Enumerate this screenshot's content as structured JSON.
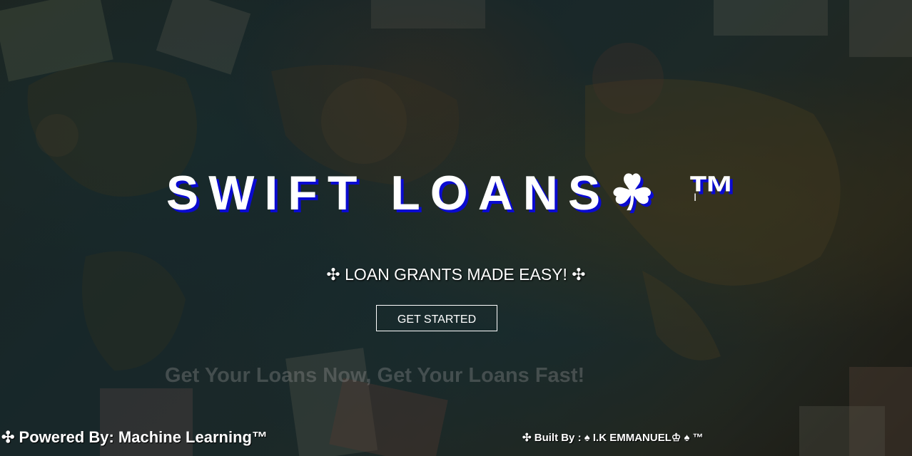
{
  "hero": {
    "title": "SWIFT LOANS☘ ™",
    "tagline": "✣ LOAN GRANTS MADE EASY! ✣",
    "cta_label": "GET STARTED",
    "slogan": "Get Your Loans Now, Get Your Loans Fast!"
  },
  "footer": {
    "powered_by": "✣ Powered By: Machine Learning™",
    "built_by": "✣ Built By : ♠ I.K EMMANUEL♔ ♠ ™"
  },
  "colors": {
    "title": "#ffffff",
    "title_shadow": "#0a0ad0",
    "button_border": "#ffffff",
    "background_tint": "#2b3f3e"
  },
  "icons": {
    "cursor": "text-cursor-icon"
  }
}
